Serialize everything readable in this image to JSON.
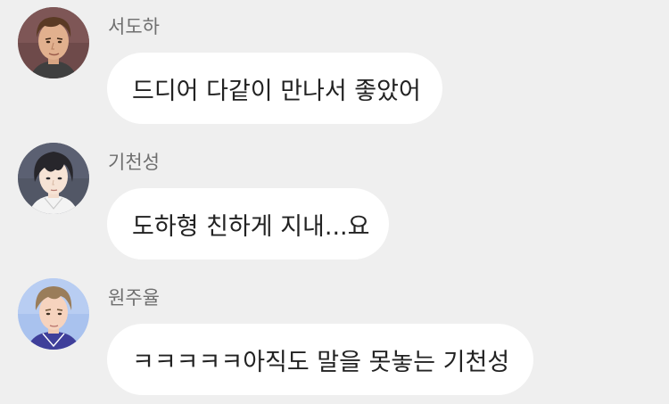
{
  "messages": [
    {
      "sender": "서도하",
      "text": "드디어 다같이 만나서 좋았어",
      "avatar_icon": "man-brown-hair-avatar-icon"
    },
    {
      "sender": "기천성",
      "text": "도하형 친하게 지내...요",
      "avatar_icon": "man-dark-hair-avatar-icon"
    },
    {
      "sender": "원주율",
      "text": "ㅋㅋㅋㅋㅋ아직도 말을 못놓는 기천성",
      "avatar_icon": "man-light-hair-avatar-icon"
    }
  ],
  "colors": {
    "background": "#efefef",
    "bubble": "#ffffff",
    "sender_text": "#6f6f6f",
    "message_text": "#222222"
  }
}
